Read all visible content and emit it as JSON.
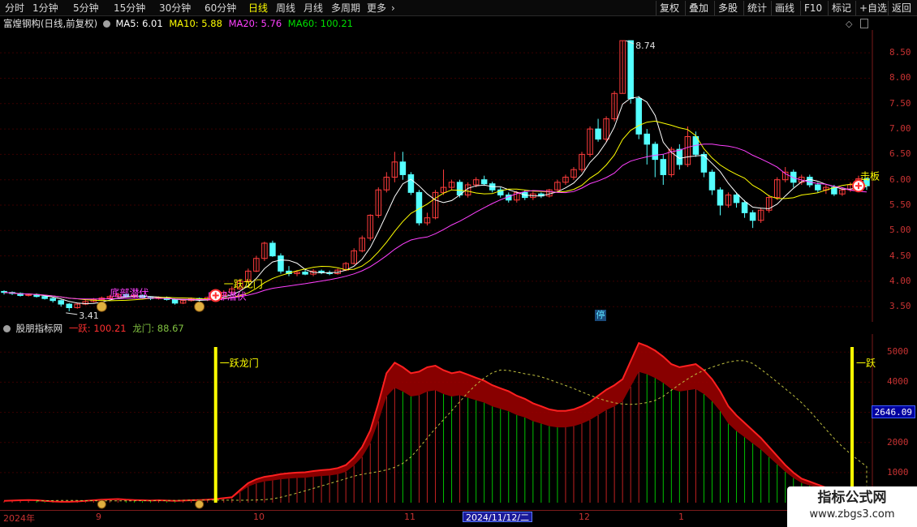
{
  "toolbar": {
    "periods": [
      "分时",
      "1分钟",
      "5分钟",
      "15分钟",
      "30分钟",
      "60分钟",
      "日线",
      "周线",
      "月线",
      "多周期",
      "更多"
    ],
    "active_period": "日线",
    "buttons": [
      "复权",
      "叠加",
      "多股",
      "统计",
      "画线",
      "F10",
      "标记",
      "+自选",
      "返回"
    ]
  },
  "main_chart": {
    "title": "富煌钢构(日线,前复权)",
    "ma5": "MA5: 6.01",
    "ma10": "MA10: 5.88",
    "ma20": "MA20: 5.76",
    "ma60": "MA60: 100.21",
    "y_ticks": [
      "8.50",
      "8.00",
      "7.50",
      "7.00",
      "6.50",
      "6.00",
      "5.50",
      "5.00",
      "4.50",
      "4.00",
      "3.50"
    ],
    "high_label": "8.74",
    "low_label": "3.41",
    "ann_tick": "一跃龙门",
    "ann_low1": "底部潜伏",
    "ann_low2": "底部潜伏",
    "ann_right": "击板",
    "stop_badge": "停"
  },
  "indicator": {
    "title": "股朋指标网",
    "v1": "一跃: 100.21",
    "v2": "龙门: 88.67",
    "y_ticks": [
      "5000",
      "4000",
      "3000",
      "2000",
      "1000"
    ],
    "current": "2646.09",
    "label_left": "一跃龙门",
    "label_right": "一跃"
  },
  "xaxis": {
    "labels": [
      "2024年",
      "9",
      "10",
      "11",
      "12",
      "1"
    ],
    "cursor_date": "2024/11/12/二"
  },
  "watermark": {
    "title": "指标公式网",
    "url": "www.zbgs3.com"
  },
  "colors": {
    "up": "#ff3c3c",
    "down": "#54ffff",
    "ma5": "#ffffff",
    "ma10": "#ffff00",
    "ma20": "#ff40ff",
    "ma60": "#00e000",
    "axis": "#c83232",
    "fill_red": "#a00000",
    "bar_green": "#00c000"
  },
  "chart_data": {
    "type": "line",
    "candles": [
      [
        3.8,
        3.78,
        3.82,
        3.74
      ],
      [
        3.78,
        3.76,
        3.8,
        3.73
      ],
      [
        3.76,
        3.72,
        3.78,
        3.7
      ],
      [
        3.72,
        3.74,
        3.76,
        3.7
      ],
      [
        3.74,
        3.7,
        3.76,
        3.68
      ],
      [
        3.7,
        3.66,
        3.72,
        3.64
      ],
      [
        3.66,
        3.62,
        3.68,
        3.58
      ],
      [
        3.62,
        3.55,
        3.64,
        3.5
      ],
      [
        3.55,
        3.48,
        3.57,
        3.41
      ],
      [
        3.48,
        3.55,
        3.58,
        3.46
      ],
      [
        3.55,
        3.6,
        3.63,
        3.53
      ],
      [
        3.6,
        3.64,
        3.67,
        3.58
      ],
      [
        3.64,
        3.67,
        3.7,
        3.62
      ],
      [
        3.67,
        3.7,
        3.73,
        3.65
      ],
      [
        3.7,
        3.74,
        3.76,
        3.68
      ],
      [
        3.74,
        3.7,
        3.76,
        3.68
      ],
      [
        3.7,
        3.72,
        3.74,
        3.67
      ],
      [
        3.72,
        3.68,
        3.74,
        3.66
      ],
      [
        3.68,
        3.66,
        3.7,
        3.63
      ],
      [
        3.66,
        3.68,
        3.7,
        3.64
      ],
      [
        3.68,
        3.64,
        3.7,
        3.62
      ],
      [
        3.64,
        3.57,
        3.66,
        3.54
      ],
      [
        3.57,
        3.62,
        3.65,
        3.55
      ],
      [
        3.62,
        3.66,
        3.68,
        3.6
      ],
      [
        3.66,
        3.63,
        3.68,
        3.6
      ],
      [
        3.63,
        3.68,
        3.7,
        3.61
      ],
      [
        3.68,
        3.72,
        3.75,
        3.66
      ],
      [
        3.72,
        3.78,
        3.82,
        3.7
      ],
      [
        3.78,
        3.85,
        3.9,
        3.76
      ],
      [
        3.85,
        4.0,
        4.05,
        3.83
      ],
      [
        4.0,
        4.2,
        4.25,
        3.98
      ],
      [
        4.2,
        4.45,
        4.5,
        4.18
      ],
      [
        4.45,
        4.75,
        4.78,
        4.4
      ],
      [
        4.75,
        4.5,
        4.8,
        4.48
      ],
      [
        4.5,
        4.2,
        4.55,
        4.15
      ],
      [
        4.2,
        4.15,
        4.3,
        4.1
      ],
      [
        4.15,
        4.18,
        4.22,
        4.1
      ],
      [
        4.18,
        4.14,
        4.25,
        4.12
      ],
      [
        4.14,
        4.2,
        4.24,
        4.1
      ],
      [
        4.2,
        4.17,
        4.23,
        4.14
      ],
      [
        4.17,
        4.15,
        4.21,
        4.12
      ],
      [
        4.15,
        4.22,
        4.25,
        4.13
      ],
      [
        4.22,
        4.35,
        4.38,
        4.2
      ],
      [
        4.35,
        4.6,
        4.65,
        4.33
      ],
      [
        4.6,
        4.85,
        4.9,
        4.57
      ],
      [
        4.85,
        5.3,
        5.32,
        4.8
      ],
      [
        5.3,
        5.8,
        5.85,
        5.25
      ],
      [
        5.8,
        6.05,
        6.15,
        5.75
      ],
      [
        6.05,
        6.35,
        6.55,
        5.95
      ],
      [
        6.35,
        6.1,
        6.55,
        6.0
      ],
      [
        6.1,
        5.75,
        6.15,
        5.7
      ],
      [
        5.75,
        5.15,
        5.8,
        5.1
      ],
      [
        5.15,
        5.25,
        5.35,
        5.1
      ],
      [
        5.25,
        5.75,
        5.8,
        5.22
      ],
      [
        5.75,
        5.85,
        6.2,
        5.7
      ],
      [
        5.85,
        5.95,
        6.0,
        5.8
      ],
      [
        5.95,
        5.7,
        6.0,
        5.65
      ],
      [
        5.7,
        5.9,
        5.95,
        5.65
      ],
      [
        5.9,
        6.0,
        6.05,
        5.85
      ],
      [
        6.0,
        5.92,
        6.08,
        5.88
      ],
      [
        5.92,
        5.8,
        5.96,
        5.75
      ],
      [
        5.8,
        5.7,
        5.85,
        5.65
      ],
      [
        5.7,
        5.6,
        5.75,
        5.55
      ],
      [
        5.6,
        5.75,
        5.78,
        5.55
      ],
      [
        5.75,
        5.65,
        5.8,
        5.6
      ],
      [
        5.65,
        5.72,
        5.76,
        5.6
      ],
      [
        5.72,
        5.68,
        5.75,
        5.64
      ],
      [
        5.68,
        5.8,
        5.82,
        5.65
      ],
      [
        5.8,
        5.95,
        6.0,
        5.75
      ],
      [
        5.95,
        6.05,
        6.1,
        5.9
      ],
      [
        6.05,
        6.2,
        6.25,
        6.0
      ],
      [
        6.2,
        6.5,
        6.55,
        6.15
      ],
      [
        6.5,
        7.0,
        7.05,
        6.45
      ],
      [
        7.0,
        6.8,
        7.2,
        6.75
      ],
      [
        6.8,
        7.2,
        7.25,
        6.75
      ],
      [
        7.2,
        7.7,
        7.75,
        7.15
      ],
      [
        7.7,
        8.74,
        8.74,
        7.7
      ],
      [
        8.74,
        7.6,
        8.74,
        7.5
      ],
      [
        7.6,
        6.9,
        7.65,
        6.8
      ],
      [
        6.9,
        6.7,
        7.0,
        6.3
      ],
      [
        6.7,
        6.4,
        6.75,
        6.05
      ],
      [
        6.4,
        6.1,
        6.5,
        5.9
      ],
      [
        6.1,
        6.6,
        6.65,
        6.05
      ],
      [
        6.6,
        6.3,
        6.7,
        6.2
      ],
      [
        6.3,
        6.85,
        7.05,
        6.25
      ],
      [
        6.85,
        6.5,
        6.95,
        6.45
      ],
      [
        6.5,
        6.15,
        6.55,
        6.05
      ],
      [
        6.15,
        5.8,
        6.2,
        5.7
      ],
      [
        5.8,
        5.5,
        5.85,
        5.3
      ],
      [
        5.5,
        5.7,
        5.75,
        5.45
      ],
      [
        5.7,
        5.55,
        5.75,
        5.45
      ],
      [
        5.55,
        5.35,
        5.6,
        5.25
      ],
      [
        5.35,
        5.2,
        5.4,
        5.05
      ],
      [
        5.2,
        5.4,
        5.45,
        5.15
      ],
      [
        5.4,
        5.65,
        5.7,
        5.35
      ],
      [
        5.65,
        6.0,
        6.05,
        5.6
      ],
      [
        6.0,
        6.15,
        6.25,
        5.95
      ],
      [
        6.15,
        5.95,
        6.2,
        5.85
      ],
      [
        5.95,
        6.05,
        6.1,
        5.9
      ],
      [
        6.05,
        5.9,
        6.1,
        5.85
      ],
      [
        5.9,
        5.8,
        5.95,
        5.75
      ],
      [
        5.8,
        5.85,
        5.9,
        5.72
      ],
      [
        5.85,
        5.72,
        5.9,
        5.68
      ],
      [
        5.72,
        5.8,
        5.85,
        5.68
      ],
      [
        5.8,
        5.9,
        5.95,
        5.76
      ],
      [
        5.9,
        6.02,
        6.08,
        5.85
      ],
      [
        6.02,
        5.88,
        6.05,
        5.8
      ]
    ],
    "indicator_values": [
      60,
      70,
      80,
      90,
      80,
      60,
      40,
      30,
      30,
      40,
      60,
      80,
      100,
      110,
      120,
      100,
      90,
      80,
      70,
      80,
      70,
      60,
      70,
      80,
      90,
      100,
      120,
      150,
      180,
      420,
      650,
      780,
      860,
      900,
      950,
      980,
      1000,
      1010,
      1050,
      1080,
      1100,
      1150,
      1250,
      1500,
      1850,
      2400,
      3300,
      4300,
      4650,
      4500,
      4300,
      4350,
      4500,
      4550,
      4400,
      4300,
      4350,
      4250,
      4150,
      4050,
      3900,
      3800,
      3700,
      3550,
      3450,
      3300,
      3200,
      3100,
      3050,
      3050,
      3100,
      3200,
      3350,
      3550,
      3750,
      3900,
      4100,
      4700,
      5300,
      5200,
      5050,
      4850,
      4600,
      4500,
      4550,
      4600,
      4400,
      4100,
      3700,
      3200,
      2900,
      2650,
      2400,
      2150,
      1850,
      1550,
      1250,
      1000,
      800,
      700,
      600,
      500,
      420,
      320,
      240,
      180,
      150
    ]
  }
}
